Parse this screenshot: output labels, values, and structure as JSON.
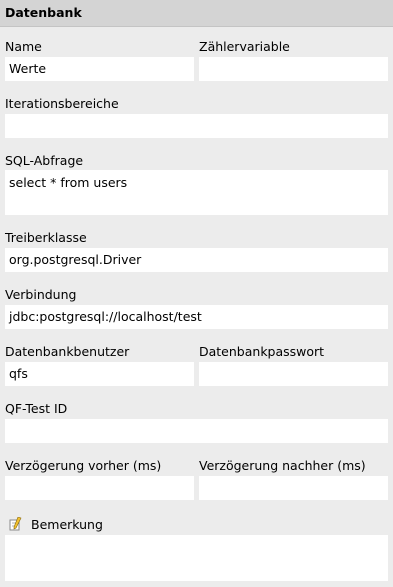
{
  "header": {
    "title": "Datenbank"
  },
  "fields": {
    "name": {
      "label": "Name",
      "value": "Werte"
    },
    "counter": {
      "label": "Zählervariable",
      "value": ""
    },
    "ranges": {
      "label": "Iterationsbereiche",
      "value": ""
    },
    "sql": {
      "label": "SQL-Abfrage",
      "value": "select * from users"
    },
    "driver": {
      "label": "Treiberklasse",
      "value": "org.postgresql.Driver"
    },
    "connection": {
      "label": "Verbindung",
      "value": "jdbc:postgresql://localhost/test"
    },
    "db_user": {
      "label": "Datenbankbenutzer",
      "value": "qfs"
    },
    "db_password": {
      "label": "Datenbankpasswort",
      "value": ""
    },
    "qftest_id": {
      "label": "QF-Test ID",
      "value": ""
    },
    "delay_before": {
      "label": "Verzögerung vorher (ms)",
      "value": ""
    },
    "delay_after": {
      "label": "Verzögerung nachher (ms)",
      "value": ""
    },
    "comment": {
      "label": "Bemerkung",
      "value": "",
      "icon": "note-pencil-icon"
    }
  }
}
